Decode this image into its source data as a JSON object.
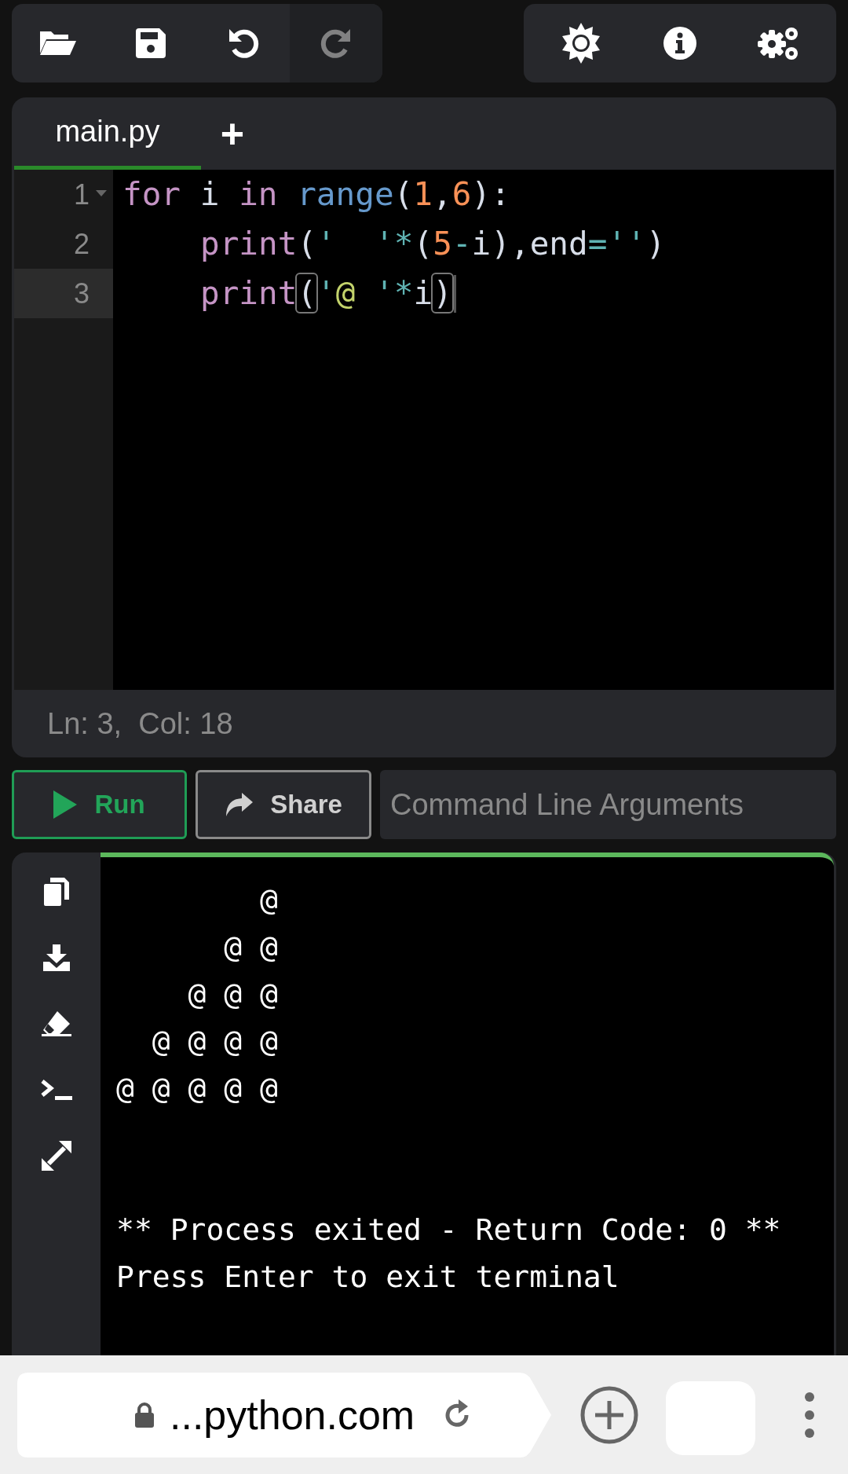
{
  "toolbar": {
    "left": [
      {
        "kind": "folder",
        "disabled": false
      },
      {
        "kind": "save",
        "disabled": false
      },
      {
        "kind": "undo",
        "disabled": false
      },
      {
        "kind": "redo",
        "disabled": true
      }
    ],
    "right": [
      {
        "kind": "sun"
      },
      {
        "kind": "info"
      },
      {
        "kind": "gears"
      }
    ]
  },
  "editor": {
    "tabs": [
      {
        "label": "main.py",
        "selected": true
      }
    ],
    "add_tab": "+",
    "lines": [
      {
        "number": "1",
        "foldable": true,
        "active": false,
        "indented": false,
        "tokens": [
          {
            "kind": "keyword",
            "text": "for"
          },
          {
            "kind": "plain",
            "text": " i "
          },
          {
            "kind": "keyword",
            "text": "in"
          },
          {
            "kind": "builtin",
            "text": " range"
          },
          {
            "kind": "plain",
            "text": "("
          },
          {
            "kind": "number",
            "text": "1"
          },
          {
            "kind": "plain",
            "text": ","
          },
          {
            "kind": "number",
            "text": "6"
          },
          {
            "kind": "plain",
            "text": "):"
          }
        ]
      },
      {
        "number": "2",
        "foldable": false,
        "active": false,
        "indented": true,
        "tokens": [
          {
            "kind": "keyword",
            "text": "print"
          },
          {
            "kind": "plain",
            "text": "("
          },
          {
            "kind": "string",
            "text": "'  '"
          },
          {
            "kind": "operator",
            "text": "*"
          },
          {
            "kind": "plain",
            "text": "("
          },
          {
            "kind": "number",
            "text": "5"
          },
          {
            "kind": "operator",
            "text": "-"
          },
          {
            "kind": "plain",
            "text": "i),end"
          },
          {
            "kind": "operator",
            "text": "="
          },
          {
            "kind": "string",
            "text": "''"
          },
          {
            "kind": "plain",
            "text": ")"
          }
        ]
      },
      {
        "number": "3",
        "foldable": false,
        "active": true,
        "indented": true,
        "tokens": [
          {
            "kind": "keyword",
            "text": "print"
          },
          {
            "kind": "bracket",
            "text": "("
          },
          {
            "kind": "string",
            "text": "'"
          },
          {
            "kind": "string_body",
            "text": "@ "
          },
          {
            "kind": "string",
            "text": "'"
          },
          {
            "kind": "operator",
            "text": "*"
          },
          {
            "kind": "plain",
            "text": "i"
          },
          {
            "kind": "bracket",
            "text": ")"
          }
        ]
      }
    ],
    "status": "Ln: 3,  Col: 18"
  },
  "actions": {
    "run": "Run",
    "share": "Share",
    "args_placeholder": "Command Line Arguments"
  },
  "terminal": {
    "tools": [
      {
        "kind": "copy"
      },
      {
        "kind": "download"
      },
      {
        "kind": "eraser"
      },
      {
        "kind": "prompt"
      },
      {
        "kind": "expand"
      }
    ],
    "output": [
      "        @",
      "      @ @",
      "    @ @ @",
      "  @ @ @ @",
      "@ @ @ @ @"
    ],
    "messages": [
      "** Process exited - Return Code: 0 **",
      "Press Enter to exit terminal"
    ]
  },
  "browser": {
    "url": "...python.com"
  }
}
